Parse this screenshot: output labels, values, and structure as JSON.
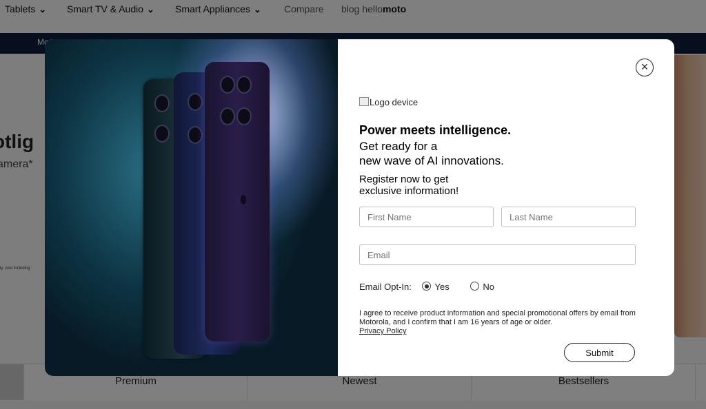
{
  "nav": {
    "items": [
      {
        "label": "Tablets",
        "chevron": true
      },
      {
        "label": "Smart TV & Audio",
        "chevron": true
      },
      {
        "label": "Smart Appliances",
        "chevron": true
      },
      {
        "label": "Compare",
        "chevron": false
      }
    ],
    "blog_prefix": "blog hello",
    "blog_suffix": "moto"
  },
  "promo_text": "Mo",
  "hero": {
    "title": "otlig",
    "subtitle": "amera*",
    "fineprint": "ly. cost including"
  },
  "tabs": [
    "Premium",
    "Newest",
    "Bestsellers"
  ],
  "modal": {
    "logo_alt": "Logo device",
    "headline": "Power meets intelligence.",
    "subhead_line1": "Get ready for a",
    "subhead_line2": "new wave of AI innovations.",
    "register_line1": "Register now to get",
    "register_line2": "exclusive information!",
    "first_name_placeholder": "First Name",
    "last_name_placeholder": "Last Name",
    "email_placeholder": "Email",
    "optin_label": "Email Opt-In:",
    "optin_yes": "Yes",
    "optin_no": "No",
    "optin_selected": "Yes",
    "consent_text": "I agree to receive product information and special promotional offers by email from Motorola, and I confirm that I am 16 years of age or older.",
    "privacy_link": "Privacy Policy",
    "submit_label": "Submit",
    "close_icon": "close-icon"
  }
}
